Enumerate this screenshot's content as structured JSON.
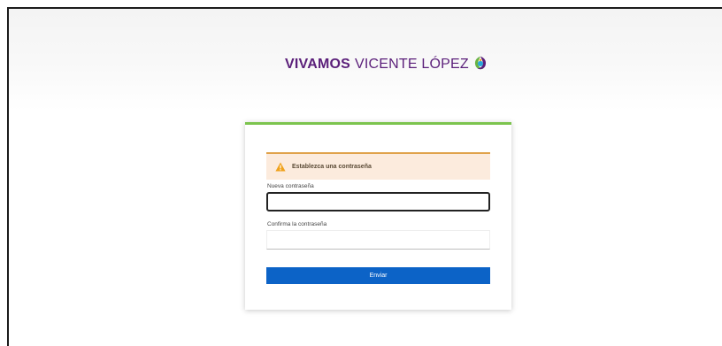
{
  "header": {
    "logo_bold": "VIVAMOS",
    "logo_light": "VICENTE LÓPEZ"
  },
  "form": {
    "alert": {
      "icon": "warning-icon",
      "message": "Establezca una contraseña"
    },
    "new_password": {
      "label": "Nueva contraseña",
      "value": ""
    },
    "confirm_password": {
      "label": "Confirma la contraseña",
      "value": ""
    },
    "submit_label": "Enviar"
  },
  "colors": {
    "brand_purple": "#5b1f7a",
    "accent_green": "#7cc44e",
    "button_blue": "#0c63c7",
    "alert_bg": "#fcebdd",
    "alert_border": "#e0a24a"
  }
}
